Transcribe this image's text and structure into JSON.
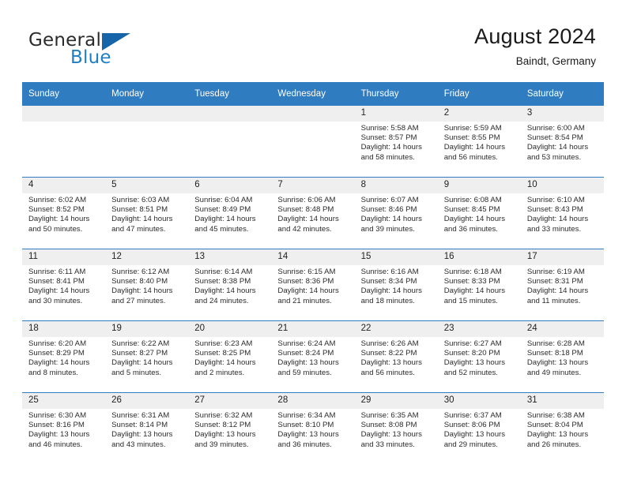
{
  "brand": {
    "name_part1": "General",
    "name_part2": "Blue",
    "accent_color": "#1f7fc4",
    "triangle_color": "#1565a8"
  },
  "header": {
    "title": "August 2024",
    "location": "Baindt, Germany"
  },
  "theme": {
    "header_bg": "#2f7cc0",
    "header_text": "#ffffff",
    "daynum_bg": "#efefef",
    "cell_bg": "#ffffff",
    "grid_line": "#2f7cc0"
  },
  "weekday_headers": [
    "Sunday",
    "Monday",
    "Tuesday",
    "Wednesday",
    "Thursday",
    "Friday",
    "Saturday"
  ],
  "weeks": [
    [
      {
        "day": "",
        "blank": true,
        "sunrise": "",
        "sunset": "",
        "daylight_line1": "",
        "daylight_line2": ""
      },
      {
        "day": "",
        "blank": true,
        "sunrise": "",
        "sunset": "",
        "daylight_line1": "",
        "daylight_line2": ""
      },
      {
        "day": "",
        "blank": true,
        "sunrise": "",
        "sunset": "",
        "daylight_line1": "",
        "daylight_line2": ""
      },
      {
        "day": "",
        "blank": true,
        "sunrise": "",
        "sunset": "",
        "daylight_line1": "",
        "daylight_line2": ""
      },
      {
        "day": "1",
        "blank": false,
        "sunrise": "Sunrise: 5:58 AM",
        "sunset": "Sunset: 8:57 PM",
        "daylight_line1": "Daylight: 14 hours",
        "daylight_line2": "and 58 minutes."
      },
      {
        "day": "2",
        "blank": false,
        "sunrise": "Sunrise: 5:59 AM",
        "sunset": "Sunset: 8:55 PM",
        "daylight_line1": "Daylight: 14 hours",
        "daylight_line2": "and 56 minutes."
      },
      {
        "day": "3",
        "blank": false,
        "sunrise": "Sunrise: 6:00 AM",
        "sunset": "Sunset: 8:54 PM",
        "daylight_line1": "Daylight: 14 hours",
        "daylight_line2": "and 53 minutes."
      }
    ],
    [
      {
        "day": "4",
        "blank": false,
        "sunrise": "Sunrise: 6:02 AM",
        "sunset": "Sunset: 8:52 PM",
        "daylight_line1": "Daylight: 14 hours",
        "daylight_line2": "and 50 minutes."
      },
      {
        "day": "5",
        "blank": false,
        "sunrise": "Sunrise: 6:03 AM",
        "sunset": "Sunset: 8:51 PM",
        "daylight_line1": "Daylight: 14 hours",
        "daylight_line2": "and 47 minutes."
      },
      {
        "day": "6",
        "blank": false,
        "sunrise": "Sunrise: 6:04 AM",
        "sunset": "Sunset: 8:49 PM",
        "daylight_line1": "Daylight: 14 hours",
        "daylight_line2": "and 45 minutes."
      },
      {
        "day": "7",
        "blank": false,
        "sunrise": "Sunrise: 6:06 AM",
        "sunset": "Sunset: 8:48 PM",
        "daylight_line1": "Daylight: 14 hours",
        "daylight_line2": "and 42 minutes."
      },
      {
        "day": "8",
        "blank": false,
        "sunrise": "Sunrise: 6:07 AM",
        "sunset": "Sunset: 8:46 PM",
        "daylight_line1": "Daylight: 14 hours",
        "daylight_line2": "and 39 minutes."
      },
      {
        "day": "9",
        "blank": false,
        "sunrise": "Sunrise: 6:08 AM",
        "sunset": "Sunset: 8:45 PM",
        "daylight_line1": "Daylight: 14 hours",
        "daylight_line2": "and 36 minutes."
      },
      {
        "day": "10",
        "blank": false,
        "sunrise": "Sunrise: 6:10 AM",
        "sunset": "Sunset: 8:43 PM",
        "daylight_line1": "Daylight: 14 hours",
        "daylight_line2": "and 33 minutes."
      }
    ],
    [
      {
        "day": "11",
        "blank": false,
        "sunrise": "Sunrise: 6:11 AM",
        "sunset": "Sunset: 8:41 PM",
        "daylight_line1": "Daylight: 14 hours",
        "daylight_line2": "and 30 minutes."
      },
      {
        "day": "12",
        "blank": false,
        "sunrise": "Sunrise: 6:12 AM",
        "sunset": "Sunset: 8:40 PM",
        "daylight_line1": "Daylight: 14 hours",
        "daylight_line2": "and 27 minutes."
      },
      {
        "day": "13",
        "blank": false,
        "sunrise": "Sunrise: 6:14 AM",
        "sunset": "Sunset: 8:38 PM",
        "daylight_line1": "Daylight: 14 hours",
        "daylight_line2": "and 24 minutes."
      },
      {
        "day": "14",
        "blank": false,
        "sunrise": "Sunrise: 6:15 AM",
        "sunset": "Sunset: 8:36 PM",
        "daylight_line1": "Daylight: 14 hours",
        "daylight_line2": "and 21 minutes."
      },
      {
        "day": "15",
        "blank": false,
        "sunrise": "Sunrise: 6:16 AM",
        "sunset": "Sunset: 8:34 PM",
        "daylight_line1": "Daylight: 14 hours",
        "daylight_line2": "and 18 minutes."
      },
      {
        "day": "16",
        "blank": false,
        "sunrise": "Sunrise: 6:18 AM",
        "sunset": "Sunset: 8:33 PM",
        "daylight_line1": "Daylight: 14 hours",
        "daylight_line2": "and 15 minutes."
      },
      {
        "day": "17",
        "blank": false,
        "sunrise": "Sunrise: 6:19 AM",
        "sunset": "Sunset: 8:31 PM",
        "daylight_line1": "Daylight: 14 hours",
        "daylight_line2": "and 11 minutes."
      }
    ],
    [
      {
        "day": "18",
        "blank": false,
        "sunrise": "Sunrise: 6:20 AM",
        "sunset": "Sunset: 8:29 PM",
        "daylight_line1": "Daylight: 14 hours",
        "daylight_line2": "and 8 minutes."
      },
      {
        "day": "19",
        "blank": false,
        "sunrise": "Sunrise: 6:22 AM",
        "sunset": "Sunset: 8:27 PM",
        "daylight_line1": "Daylight: 14 hours",
        "daylight_line2": "and 5 minutes."
      },
      {
        "day": "20",
        "blank": false,
        "sunrise": "Sunrise: 6:23 AM",
        "sunset": "Sunset: 8:25 PM",
        "daylight_line1": "Daylight: 14 hours",
        "daylight_line2": "and 2 minutes."
      },
      {
        "day": "21",
        "blank": false,
        "sunrise": "Sunrise: 6:24 AM",
        "sunset": "Sunset: 8:24 PM",
        "daylight_line1": "Daylight: 13 hours",
        "daylight_line2": "and 59 minutes."
      },
      {
        "day": "22",
        "blank": false,
        "sunrise": "Sunrise: 6:26 AM",
        "sunset": "Sunset: 8:22 PM",
        "daylight_line1": "Daylight: 13 hours",
        "daylight_line2": "and 56 minutes."
      },
      {
        "day": "23",
        "blank": false,
        "sunrise": "Sunrise: 6:27 AM",
        "sunset": "Sunset: 8:20 PM",
        "daylight_line1": "Daylight: 13 hours",
        "daylight_line2": "and 52 minutes."
      },
      {
        "day": "24",
        "blank": false,
        "sunrise": "Sunrise: 6:28 AM",
        "sunset": "Sunset: 8:18 PM",
        "daylight_line1": "Daylight: 13 hours",
        "daylight_line2": "and 49 minutes."
      }
    ],
    [
      {
        "day": "25",
        "blank": false,
        "sunrise": "Sunrise: 6:30 AM",
        "sunset": "Sunset: 8:16 PM",
        "daylight_line1": "Daylight: 13 hours",
        "daylight_line2": "and 46 minutes."
      },
      {
        "day": "26",
        "blank": false,
        "sunrise": "Sunrise: 6:31 AM",
        "sunset": "Sunset: 8:14 PM",
        "daylight_line1": "Daylight: 13 hours",
        "daylight_line2": "and 43 minutes."
      },
      {
        "day": "27",
        "blank": false,
        "sunrise": "Sunrise: 6:32 AM",
        "sunset": "Sunset: 8:12 PM",
        "daylight_line1": "Daylight: 13 hours",
        "daylight_line2": "and 39 minutes."
      },
      {
        "day": "28",
        "blank": false,
        "sunrise": "Sunrise: 6:34 AM",
        "sunset": "Sunset: 8:10 PM",
        "daylight_line1": "Daylight: 13 hours",
        "daylight_line2": "and 36 minutes."
      },
      {
        "day": "29",
        "blank": false,
        "sunrise": "Sunrise: 6:35 AM",
        "sunset": "Sunset: 8:08 PM",
        "daylight_line1": "Daylight: 13 hours",
        "daylight_line2": "and 33 minutes."
      },
      {
        "day": "30",
        "blank": false,
        "sunrise": "Sunrise: 6:37 AM",
        "sunset": "Sunset: 8:06 PM",
        "daylight_line1": "Daylight: 13 hours",
        "daylight_line2": "and 29 minutes."
      },
      {
        "day": "31",
        "blank": false,
        "sunrise": "Sunrise: 6:38 AM",
        "sunset": "Sunset: 8:04 PM",
        "daylight_line1": "Daylight: 13 hours",
        "daylight_line2": "and 26 minutes."
      }
    ]
  ]
}
